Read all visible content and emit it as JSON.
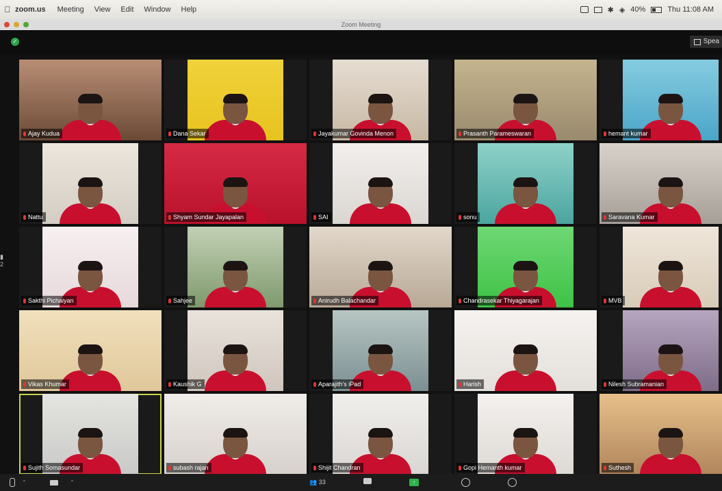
{
  "menubar": {
    "app": "zoom.us",
    "menus": [
      "Meeting",
      "View",
      "Edit",
      "Window",
      "Help"
    ],
    "battery": "40%",
    "clock": "Thu 11:08 AM"
  },
  "window": {
    "title": "Zoom Meeting"
  },
  "toolbar": {
    "speaker_view_label": "Spea"
  },
  "participants": [
    {
      "name": "Ajay Kudua",
      "bg": "#6b4a36",
      "wall": "#b98e75"
    },
    {
      "name": "Dana Sekar",
      "bg": "#e7c31f",
      "wall": "#f0d23a"
    },
    {
      "name": "Jayakumar Govinda Menon",
      "bg": "#c8b8a4",
      "wall": "#e6ddd2"
    },
    {
      "name": "Prasanth Parameswaran",
      "bg": "#9a8a6e",
      "wall": "#c4b48e"
    },
    {
      "name": "hemant kumar",
      "bg": "#4aa5c8",
      "wall": "#86cce0"
    },
    {
      "name": "Nattu",
      "bg": "#d3cdc4",
      "wall": "#ece6dd"
    },
    {
      "name": "Shyam Sundar Jayapalan",
      "bg": "#b9112c",
      "wall": "#d62a45"
    },
    {
      "name": "SAI",
      "bg": "#dad6d2",
      "wall": "#f2efec"
    },
    {
      "name": "sonu",
      "bg": "#4ba59f",
      "wall": "#8ed2c9"
    },
    {
      "name": "Saravana Kumar",
      "bg": "#a69f98",
      "wall": "#d8d2cb"
    },
    {
      "name": "Sakthi Pichaiyan",
      "bg": "#e6d9db",
      "wall": "#f7eff0"
    },
    {
      "name": "Sahjee",
      "bg": "#7f9a6d",
      "wall": "#c2d0b4"
    },
    {
      "name": "Anirudh Balachandar",
      "bg": "#b8a896",
      "wall": "#e2d8cb"
    },
    {
      "name": "Chandrasekar Thiyagarajan",
      "bg": "#3ec246",
      "wall": "#6fd874"
    },
    {
      "name": "MVB",
      "bg": "#d8cbb8",
      "wall": "#efe6da"
    },
    {
      "name": "Vikas Khumar",
      "bg": "#e0c79a",
      "wall": "#f1e0bc"
    },
    {
      "name": "Kaushik G",
      "bg": "#cfc6bd",
      "wall": "#e9e3dc"
    },
    {
      "name": "Aparajith's iPad",
      "bg": "#7c8f92",
      "wall": "#b7c6c3"
    },
    {
      "name": "Harish",
      "bg": "#e4e0dc",
      "wall": "#f5f2ef"
    },
    {
      "name": "Nilesh Subramanian",
      "bg": "#7e6c88",
      "wall": "#b7a6c0"
    },
    {
      "name": "Sujith Somasundar",
      "bg": "#c9c9c7",
      "wall": "#e4e4e1",
      "active": true
    },
    {
      "name": "subash rajan",
      "bg": "#d6d1cc",
      "wall": "#f0ece7"
    },
    {
      "name": "Shijit Chandran",
      "bg": "#d9d6d3",
      "wall": "#f1efec"
    },
    {
      "name": "Gopi Hemanth kumar",
      "bg": "#ddd9d5",
      "wall": "#f4f1ee"
    },
    {
      "name": "Suthesh",
      "bg": "#b0855c",
      "wall": "#e7c08a"
    }
  ],
  "bottombar": {
    "participants_count": "33"
  },
  "colors": {
    "jersey": "#c8102e",
    "active_outline": "#c9d44d",
    "share_green": "#2db24a"
  }
}
